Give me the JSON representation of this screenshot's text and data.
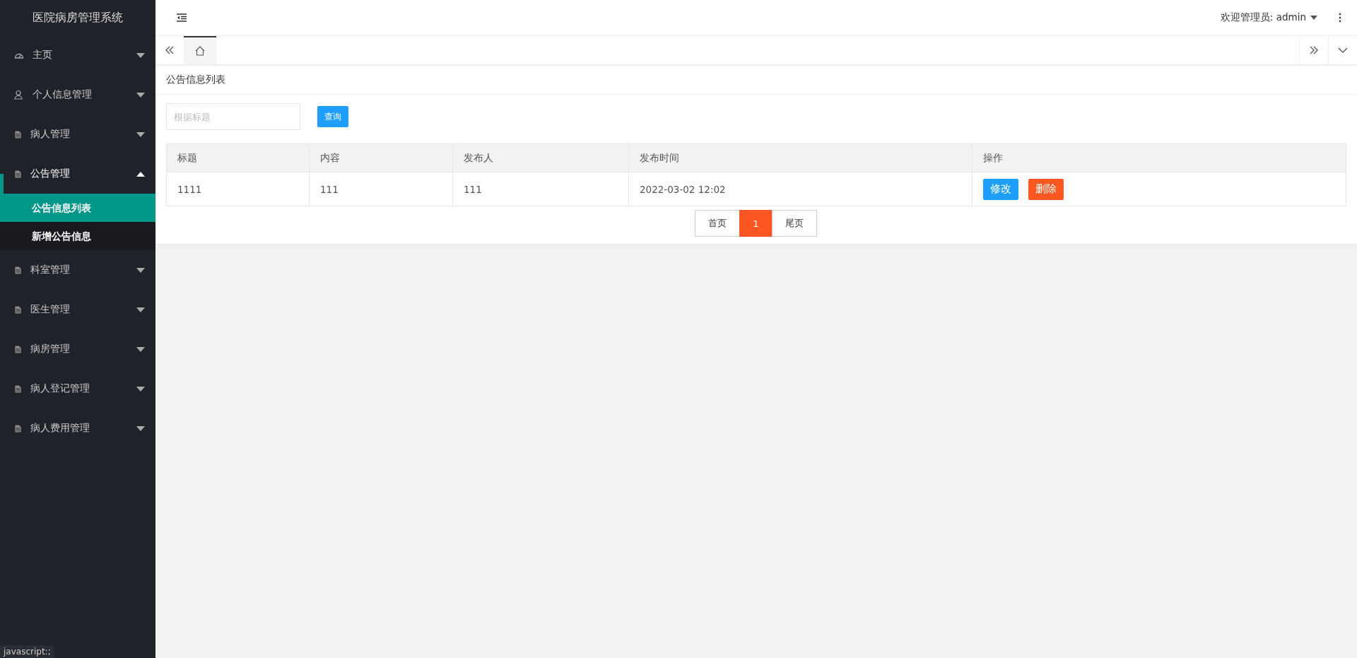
{
  "sidebar": {
    "title": "医院病房管理系统",
    "items": [
      {
        "label": "主页",
        "expanded": false
      },
      {
        "label": "个人信息管理",
        "expanded": false
      },
      {
        "label": "病人管理",
        "expanded": false
      },
      {
        "label": "公告管理",
        "expanded": true,
        "children": [
          {
            "label": "公告信息列表",
            "selected": true
          },
          {
            "label": "新增公告信息",
            "selected": false
          }
        ]
      },
      {
        "label": "科室管理",
        "expanded": false
      },
      {
        "label": "医生管理",
        "expanded": false
      },
      {
        "label": "病房管理",
        "expanded": false
      },
      {
        "label": "病人登记管理",
        "expanded": false
      },
      {
        "label": "病人费用管理",
        "expanded": false
      }
    ]
  },
  "header": {
    "user": "欢迎管理员: admin"
  },
  "page_title": "公告信息列表",
  "search": {
    "placeholder": "根据标题",
    "button": "查询"
  },
  "table": {
    "columns": [
      "标题",
      "内容",
      "发布人",
      "发布时间",
      "操作"
    ],
    "rows": [
      {
        "cells": [
          "1111",
          "111",
          "111",
          "2022-03-02 12:02"
        ],
        "actions": [
          "修改",
          "删除"
        ]
      }
    ]
  },
  "pagination": [
    {
      "label": "首页",
      "selected": false
    },
    {
      "label": "1",
      "selected": true
    },
    {
      "label": "尾页",
      "selected": false
    }
  ],
  "status_bar": "javascript:;"
}
